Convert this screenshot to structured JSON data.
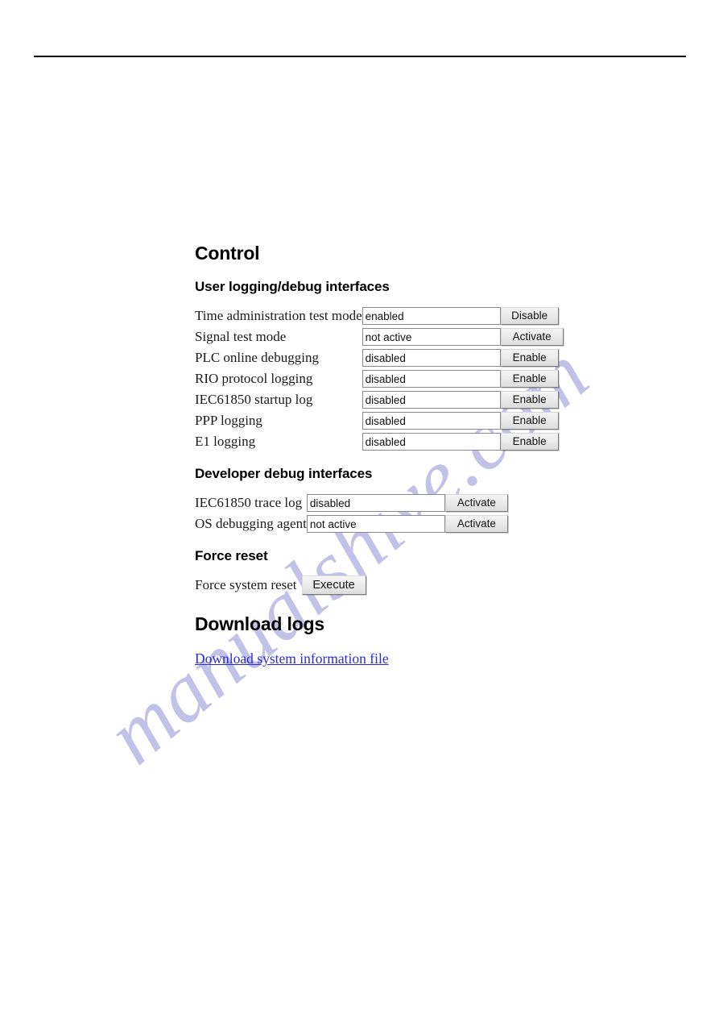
{
  "document": {
    "page_background": "#ffffff",
    "rule_color": "#000000"
  },
  "watermark": {
    "text": "manualshive.com",
    "color": "#c2c2e8"
  },
  "main": {
    "title": "Control",
    "sections": [
      {
        "heading": "User logging/debug interfaces",
        "rows": [
          {
            "label": "Time administration test mode",
            "value": "enabled",
            "button": "Disable"
          },
          {
            "label": "Signal test mode",
            "value": "not active",
            "button": "Activate"
          },
          {
            "label": "PLC online debugging",
            "value": "disabled",
            "button": "Enable"
          },
          {
            "label": "RIO protocol logging",
            "value": "disabled",
            "button": "Enable"
          },
          {
            "label": "IEC61850 startup log",
            "value": "disabled",
            "button": "Enable"
          },
          {
            "label": "PPP logging",
            "value": "disabled",
            "button": "Enable"
          },
          {
            "label": "E1 logging",
            "value": "disabled",
            "button": "Enable"
          }
        ]
      },
      {
        "heading": "Developer debug interfaces",
        "rows": [
          {
            "label": "IEC61850 trace log",
            "value": "disabled",
            "button": "Activate"
          },
          {
            "label": "OS debugging agent",
            "value": "not active",
            "button": "Activate"
          }
        ]
      },
      {
        "heading": "Force reset",
        "rows": [
          {
            "label": "Force system reset",
            "button": "Execute"
          }
        ]
      }
    ],
    "download": {
      "title": "Download logs",
      "link_text": "Download system information file",
      "link_color": "#2b2bd4"
    }
  }
}
